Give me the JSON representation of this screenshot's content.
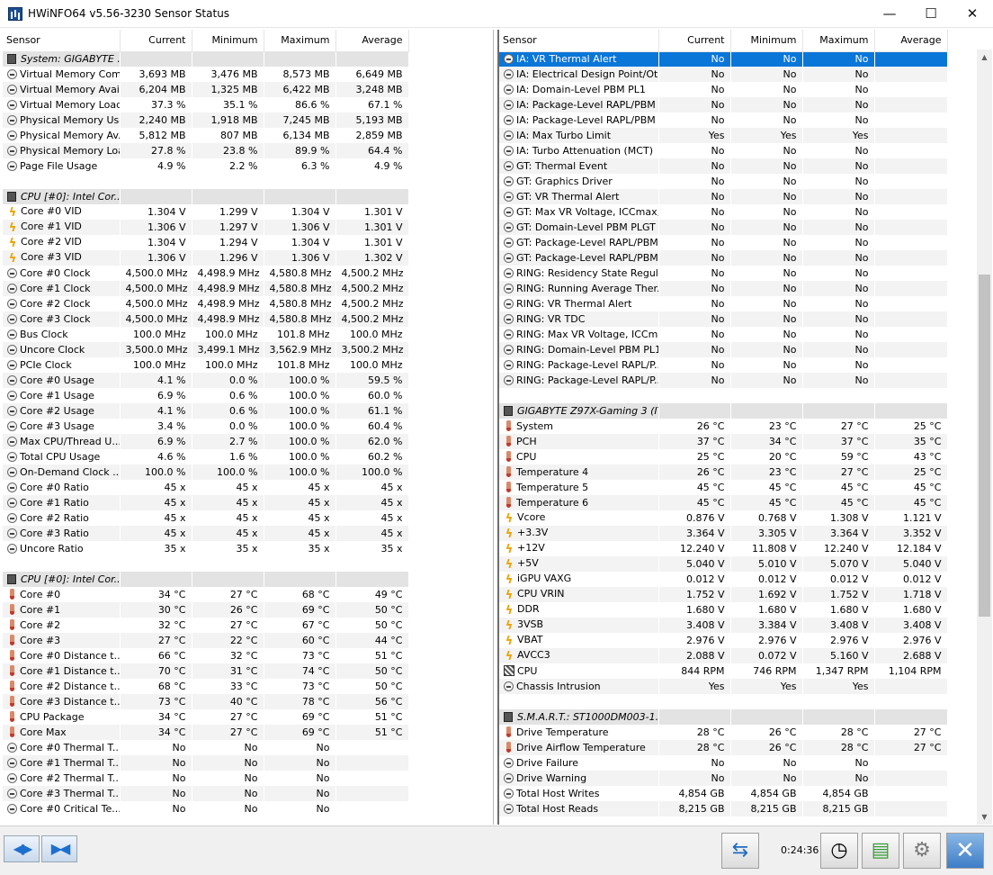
{
  "window": {
    "title": "HWiNFO64 v5.56-3230 Sensor Status",
    "min": "—",
    "max": "☐",
    "close": "✕"
  },
  "columns": [
    "Sensor",
    "Current",
    "Minimum",
    "Maximum",
    "Average"
  ],
  "left_rows": [
    {
      "t": "g",
      "n": "System: GIGABYTE ..."
    },
    {
      "t": "r",
      "i": "gauge",
      "n": "Virtual Memory Com...",
      "v": [
        "3,693 MB",
        "3,476 MB",
        "8,573 MB",
        "6,649 MB"
      ]
    },
    {
      "t": "r",
      "i": "gauge",
      "n": "Virtual Memory Avai...",
      "v": [
        "6,204 MB",
        "1,325 MB",
        "6,422 MB",
        "3,248 MB"
      ]
    },
    {
      "t": "r",
      "i": "gauge",
      "n": "Virtual Memory Load",
      "v": [
        "37.3 %",
        "35.1 %",
        "86.6 %",
        "67.1 %"
      ]
    },
    {
      "t": "r",
      "i": "gauge",
      "n": "Physical Memory Used",
      "v": [
        "2,240 MB",
        "1,918 MB",
        "7,245 MB",
        "5,193 MB"
      ]
    },
    {
      "t": "r",
      "i": "gauge",
      "n": "Physical Memory Av...",
      "v": [
        "5,812 MB",
        "807 MB",
        "6,134 MB",
        "2,859 MB"
      ]
    },
    {
      "t": "r",
      "i": "gauge",
      "n": "Physical Memory Load",
      "v": [
        "27.8 %",
        "23.8 %",
        "89.9 %",
        "64.4 %"
      ]
    },
    {
      "t": "r",
      "i": "gauge",
      "n": "Page File Usage",
      "v": [
        "4.9 %",
        "2.2 %",
        "6.3 %",
        "4.9 %"
      ]
    },
    {
      "t": "s"
    },
    {
      "t": "g",
      "n": "CPU [#0]: Intel Cor..."
    },
    {
      "t": "r",
      "i": "volt",
      "n": "Core #0 VID",
      "v": [
        "1.304 V",
        "1.299 V",
        "1.304 V",
        "1.301 V"
      ]
    },
    {
      "t": "r",
      "i": "volt",
      "n": "Core #1 VID",
      "v": [
        "1.306 V",
        "1.297 V",
        "1.306 V",
        "1.301 V"
      ]
    },
    {
      "t": "r",
      "i": "volt",
      "n": "Core #2 VID",
      "v": [
        "1.304 V",
        "1.294 V",
        "1.304 V",
        "1.301 V"
      ]
    },
    {
      "t": "r",
      "i": "volt",
      "n": "Core #3 VID",
      "v": [
        "1.306 V",
        "1.296 V",
        "1.306 V",
        "1.302 V"
      ]
    },
    {
      "t": "r",
      "i": "gauge",
      "n": "Core #0 Clock",
      "v": [
        "4,500.0 MHz",
        "4,498.9 MHz",
        "4,580.8 MHz",
        "4,500.2 MHz"
      ]
    },
    {
      "t": "r",
      "i": "gauge",
      "n": "Core #1 Clock",
      "v": [
        "4,500.0 MHz",
        "4,498.9 MHz",
        "4,580.8 MHz",
        "4,500.2 MHz"
      ]
    },
    {
      "t": "r",
      "i": "gauge",
      "n": "Core #2 Clock",
      "v": [
        "4,500.0 MHz",
        "4,498.9 MHz",
        "4,580.8 MHz",
        "4,500.2 MHz"
      ]
    },
    {
      "t": "r",
      "i": "gauge",
      "n": "Core #3 Clock",
      "v": [
        "4,500.0 MHz",
        "4,498.9 MHz",
        "4,580.8 MHz",
        "4,500.2 MHz"
      ]
    },
    {
      "t": "r",
      "i": "gauge",
      "n": "Bus Clock",
      "v": [
        "100.0 MHz",
        "100.0 MHz",
        "101.8 MHz",
        "100.0 MHz"
      ]
    },
    {
      "t": "r",
      "i": "gauge",
      "n": "Uncore Clock",
      "v": [
        "3,500.0 MHz",
        "3,499.1 MHz",
        "3,562.9 MHz",
        "3,500.2 MHz"
      ]
    },
    {
      "t": "r",
      "i": "gauge",
      "n": "PCIe Clock",
      "v": [
        "100.0 MHz",
        "100.0 MHz",
        "101.8 MHz",
        "100.0 MHz"
      ]
    },
    {
      "t": "r",
      "i": "gauge",
      "n": "Core #0 Usage",
      "v": [
        "4.1 %",
        "0.0 %",
        "100.0 %",
        "59.5 %"
      ]
    },
    {
      "t": "r",
      "i": "gauge",
      "n": "Core #1 Usage",
      "v": [
        "6.9 %",
        "0.6 %",
        "100.0 %",
        "60.0 %"
      ]
    },
    {
      "t": "r",
      "i": "gauge",
      "n": "Core #2 Usage",
      "v": [
        "4.1 %",
        "0.6 %",
        "100.0 %",
        "61.1 %"
      ]
    },
    {
      "t": "r",
      "i": "gauge",
      "n": "Core #3 Usage",
      "v": [
        "3.4 %",
        "0.0 %",
        "100.0 %",
        "60.4 %"
      ]
    },
    {
      "t": "r",
      "i": "gauge",
      "n": "Max CPU/Thread U...",
      "v": [
        "6.9 %",
        "2.7 %",
        "100.0 %",
        "62.0 %"
      ]
    },
    {
      "t": "r",
      "i": "gauge",
      "n": "Total CPU Usage",
      "v": [
        "4.6 %",
        "1.6 %",
        "100.0 %",
        "60.2 %"
      ]
    },
    {
      "t": "r",
      "i": "gauge",
      "n": "On-Demand Clock ...",
      "v": [
        "100.0 %",
        "100.0 %",
        "100.0 %",
        "100.0 %"
      ]
    },
    {
      "t": "r",
      "i": "gauge",
      "n": "Core #0 Ratio",
      "v": [
        "45 x",
        "45 x",
        "45 x",
        "45 x"
      ]
    },
    {
      "t": "r",
      "i": "gauge",
      "n": "Core #1 Ratio",
      "v": [
        "45 x",
        "45 x",
        "45 x",
        "45 x"
      ]
    },
    {
      "t": "r",
      "i": "gauge",
      "n": "Core #2 Ratio",
      "v": [
        "45 x",
        "45 x",
        "45 x",
        "45 x"
      ]
    },
    {
      "t": "r",
      "i": "gauge",
      "n": "Core #3 Ratio",
      "v": [
        "45 x",
        "45 x",
        "45 x",
        "45 x"
      ]
    },
    {
      "t": "r",
      "i": "gauge",
      "n": "Uncore Ratio",
      "v": [
        "35 x",
        "35 x",
        "35 x",
        "35 x"
      ]
    },
    {
      "t": "s"
    },
    {
      "t": "g",
      "n": "CPU [#0]: Intel Cor..."
    },
    {
      "t": "r",
      "i": "therm",
      "n": "Core #0",
      "v": [
        "34 °C",
        "27 °C",
        "68 °C",
        "49 °C"
      ]
    },
    {
      "t": "r",
      "i": "therm",
      "n": "Core #1",
      "v": [
        "30 °C",
        "26 °C",
        "69 °C",
        "50 °C"
      ]
    },
    {
      "t": "r",
      "i": "therm",
      "n": "Core #2",
      "v": [
        "32 °C",
        "27 °C",
        "67 °C",
        "50 °C"
      ]
    },
    {
      "t": "r",
      "i": "therm",
      "n": "Core #3",
      "v": [
        "27 °C",
        "22 °C",
        "60 °C",
        "44 °C"
      ]
    },
    {
      "t": "r",
      "i": "therm",
      "n": "Core #0 Distance t...",
      "v": [
        "66 °C",
        "32 °C",
        "73 °C",
        "51 °C"
      ]
    },
    {
      "t": "r",
      "i": "therm",
      "n": "Core #1 Distance t...",
      "v": [
        "70 °C",
        "31 °C",
        "74 °C",
        "50 °C"
      ]
    },
    {
      "t": "r",
      "i": "therm",
      "n": "Core #2 Distance t...",
      "v": [
        "68 °C",
        "33 °C",
        "73 °C",
        "50 °C"
      ]
    },
    {
      "t": "r",
      "i": "therm",
      "n": "Core #3 Distance t...",
      "v": [
        "73 °C",
        "40 °C",
        "78 °C",
        "56 °C"
      ]
    },
    {
      "t": "r",
      "i": "therm",
      "n": "CPU Package",
      "v": [
        "34 °C",
        "27 °C",
        "69 °C",
        "51 °C"
      ]
    },
    {
      "t": "r",
      "i": "therm",
      "n": "Core Max",
      "v": [
        "34 °C",
        "27 °C",
        "69 °C",
        "51 °C"
      ]
    },
    {
      "t": "r",
      "i": "gauge",
      "n": "Core #0 Thermal T...",
      "v": [
        "No",
        "No",
        "No",
        ""
      ]
    },
    {
      "t": "r",
      "i": "gauge",
      "n": "Core #1 Thermal T...",
      "v": [
        "No",
        "No",
        "No",
        ""
      ]
    },
    {
      "t": "r",
      "i": "gauge",
      "n": "Core #2 Thermal T...",
      "v": [
        "No",
        "No",
        "No",
        ""
      ]
    },
    {
      "t": "r",
      "i": "gauge",
      "n": "Core #3 Thermal T...",
      "v": [
        "No",
        "No",
        "No",
        ""
      ]
    },
    {
      "t": "r",
      "i": "gauge",
      "n": "Core #0 Critical Te...",
      "v": [
        "No",
        "No",
        "No",
        ""
      ]
    }
  ],
  "right_rows": [
    {
      "t": "r",
      "i": "gauge",
      "sel": true,
      "n": "IA: VR Thermal Alert",
      "v": [
        "No",
        "No",
        "No",
        ""
      ]
    },
    {
      "t": "r",
      "i": "gauge",
      "n": "IA: Electrical Design Point/Ot...",
      "v": [
        "No",
        "No",
        "No",
        ""
      ]
    },
    {
      "t": "r",
      "i": "gauge",
      "n": "IA: Domain-Level PBM PL1",
      "v": [
        "No",
        "No",
        "No",
        ""
      ]
    },
    {
      "t": "r",
      "i": "gauge",
      "n": "IA: Package-Level RAPL/PBM ...",
      "v": [
        "No",
        "No",
        "No",
        ""
      ]
    },
    {
      "t": "r",
      "i": "gauge",
      "n": "IA: Package-Level RAPL/PBM ...",
      "v": [
        "No",
        "No",
        "No",
        ""
      ]
    },
    {
      "t": "r",
      "i": "gauge",
      "n": "IA: Max Turbo Limit",
      "v": [
        "Yes",
        "Yes",
        "Yes",
        ""
      ]
    },
    {
      "t": "r",
      "i": "gauge",
      "n": "IA: Turbo Attenuation (MCT)",
      "v": [
        "No",
        "No",
        "No",
        ""
      ]
    },
    {
      "t": "r",
      "i": "gauge",
      "n": "GT: Thermal Event",
      "v": [
        "No",
        "No",
        "No",
        ""
      ]
    },
    {
      "t": "r",
      "i": "gauge",
      "n": "GT: Graphics Driver",
      "v": [
        "No",
        "No",
        "No",
        ""
      ]
    },
    {
      "t": "r",
      "i": "gauge",
      "n": "GT: VR Thermal Alert",
      "v": [
        "No",
        "No",
        "No",
        ""
      ]
    },
    {
      "t": "r",
      "i": "gauge",
      "n": "GT: Max VR Voltage, ICCmax, ...",
      "v": [
        "No",
        "No",
        "No",
        ""
      ]
    },
    {
      "t": "r",
      "i": "gauge",
      "n": "GT: Domain-Level PBM PLGT",
      "v": [
        "No",
        "No",
        "No",
        ""
      ]
    },
    {
      "t": "r",
      "i": "gauge",
      "n": "GT: Package-Level RAPL/PBM...",
      "v": [
        "No",
        "No",
        "No",
        ""
      ]
    },
    {
      "t": "r",
      "i": "gauge",
      "n": "GT: Package-Level RAPL/PBM...",
      "v": [
        "No",
        "No",
        "No",
        ""
      ]
    },
    {
      "t": "r",
      "i": "gauge",
      "n": "RING: Residency State Regul...",
      "v": [
        "No",
        "No",
        "No",
        ""
      ]
    },
    {
      "t": "r",
      "i": "gauge",
      "n": "RING: Running Average Ther...",
      "v": [
        "No",
        "No",
        "No",
        ""
      ]
    },
    {
      "t": "r",
      "i": "gauge",
      "n": "RING: VR Thermal Alert",
      "v": [
        "No",
        "No",
        "No",
        ""
      ]
    },
    {
      "t": "r",
      "i": "gauge",
      "n": "RING: VR TDC",
      "v": [
        "No",
        "No",
        "No",
        ""
      ]
    },
    {
      "t": "r",
      "i": "gauge",
      "n": "RING: Max VR Voltage, ICCm...",
      "v": [
        "No",
        "No",
        "No",
        ""
      ]
    },
    {
      "t": "r",
      "i": "gauge",
      "n": "RING: Domain-Level PBM PL1",
      "v": [
        "No",
        "No",
        "No",
        ""
      ]
    },
    {
      "t": "r",
      "i": "gauge",
      "n": "RING: Package-Level RAPL/P...",
      "v": [
        "No",
        "No",
        "No",
        ""
      ]
    },
    {
      "t": "r",
      "i": "gauge",
      "n": "RING: Package-Level RAPL/P...",
      "v": [
        "No",
        "No",
        "No",
        ""
      ]
    },
    {
      "t": "s"
    },
    {
      "t": "g",
      "n": "GIGABYTE Z97X-Gaming 3 (IT..."
    },
    {
      "t": "r",
      "i": "therm",
      "n": "System",
      "v": [
        "26 °C",
        "23 °C",
        "27 °C",
        "25 °C"
      ]
    },
    {
      "t": "r",
      "i": "therm",
      "n": "PCH",
      "v": [
        "37 °C",
        "34 °C",
        "37 °C",
        "35 °C"
      ]
    },
    {
      "t": "r",
      "i": "therm",
      "n": "CPU",
      "v": [
        "25 °C",
        "20 °C",
        "59 °C",
        "43 °C"
      ]
    },
    {
      "t": "r",
      "i": "therm",
      "n": "Temperature 4",
      "v": [
        "26 °C",
        "23 °C",
        "27 °C",
        "25 °C"
      ]
    },
    {
      "t": "r",
      "i": "therm",
      "n": "Temperature 5",
      "v": [
        "45 °C",
        "45 °C",
        "45 °C",
        "45 °C"
      ]
    },
    {
      "t": "r",
      "i": "therm",
      "n": "Temperature 6",
      "v": [
        "45 °C",
        "45 °C",
        "45 °C",
        "45 °C"
      ]
    },
    {
      "t": "r",
      "i": "volt",
      "n": "Vcore",
      "v": [
        "0.876 V",
        "0.768 V",
        "1.308 V",
        "1.121 V"
      ]
    },
    {
      "t": "r",
      "i": "volt",
      "n": "+3.3V",
      "v": [
        "3.364 V",
        "3.305 V",
        "3.364 V",
        "3.352 V"
      ]
    },
    {
      "t": "r",
      "i": "volt",
      "n": "+12V",
      "v": [
        "12.240 V",
        "11.808 V",
        "12.240 V",
        "12.184 V"
      ]
    },
    {
      "t": "r",
      "i": "volt",
      "n": "+5V",
      "v": [
        "5.040 V",
        "5.010 V",
        "5.070 V",
        "5.040 V"
      ]
    },
    {
      "t": "r",
      "i": "volt",
      "n": "iGPU VAXG",
      "v": [
        "0.012 V",
        "0.012 V",
        "0.012 V",
        "0.012 V"
      ]
    },
    {
      "t": "r",
      "i": "volt",
      "n": "CPU VRIN",
      "v": [
        "1.752 V",
        "1.692 V",
        "1.752 V",
        "1.718 V"
      ]
    },
    {
      "t": "r",
      "i": "volt",
      "n": "DDR",
      "v": [
        "1.680 V",
        "1.680 V",
        "1.680 V",
        "1.680 V"
      ]
    },
    {
      "t": "r",
      "i": "volt",
      "n": "3VSB",
      "v": [
        "3.408 V",
        "3.384 V",
        "3.408 V",
        "3.408 V"
      ]
    },
    {
      "t": "r",
      "i": "volt",
      "n": "VBAT",
      "v": [
        "2.976 V",
        "2.976 V",
        "2.976 V",
        "2.976 V"
      ]
    },
    {
      "t": "r",
      "i": "volt",
      "n": "AVCC3",
      "v": [
        "2.088 V",
        "0.072 V",
        "5.160 V",
        "2.688 V"
      ]
    },
    {
      "t": "r",
      "i": "fan",
      "n": "CPU",
      "v": [
        "844 RPM",
        "746 RPM",
        "1,347 RPM",
        "1,104 RPM"
      ]
    },
    {
      "t": "r",
      "i": "gauge",
      "n": "Chassis Intrusion",
      "v": [
        "Yes",
        "Yes",
        "Yes",
        ""
      ]
    },
    {
      "t": "s"
    },
    {
      "t": "g",
      "n": "S.M.A.R.T.: ST1000DM003-1..."
    },
    {
      "t": "r",
      "i": "therm",
      "n": "Drive Temperature",
      "v": [
        "28 °C",
        "26 °C",
        "28 °C",
        "27 °C"
      ]
    },
    {
      "t": "r",
      "i": "therm",
      "n": "Drive Airflow Temperature",
      "v": [
        "28 °C",
        "26 °C",
        "28 °C",
        "27 °C"
      ]
    },
    {
      "t": "r",
      "i": "gauge",
      "n": "Drive Failure",
      "v": [
        "No",
        "No",
        "No",
        ""
      ]
    },
    {
      "t": "r",
      "i": "gauge",
      "n": "Drive Warning",
      "v": [
        "No",
        "No",
        "No",
        ""
      ]
    },
    {
      "t": "r",
      "i": "gauge",
      "n": "Total Host Writes",
      "v": [
        "4,854 GB",
        "4,854 GB",
        "4,854 GB",
        ""
      ]
    },
    {
      "t": "r",
      "i": "gauge",
      "n": "Total Host Reads",
      "v": [
        "8,215 GB",
        "8,215 GB",
        "8,215 GB",
        ""
      ]
    }
  ],
  "footer": {
    "elapsed": "0:24:36"
  },
  "icons": {
    "left_arrows": "◀▶",
    "right_arrows": "▶◀",
    "network": "⇆",
    "clock": "◷",
    "report": "▤",
    "settings": "⚙",
    "close": "✕"
  }
}
